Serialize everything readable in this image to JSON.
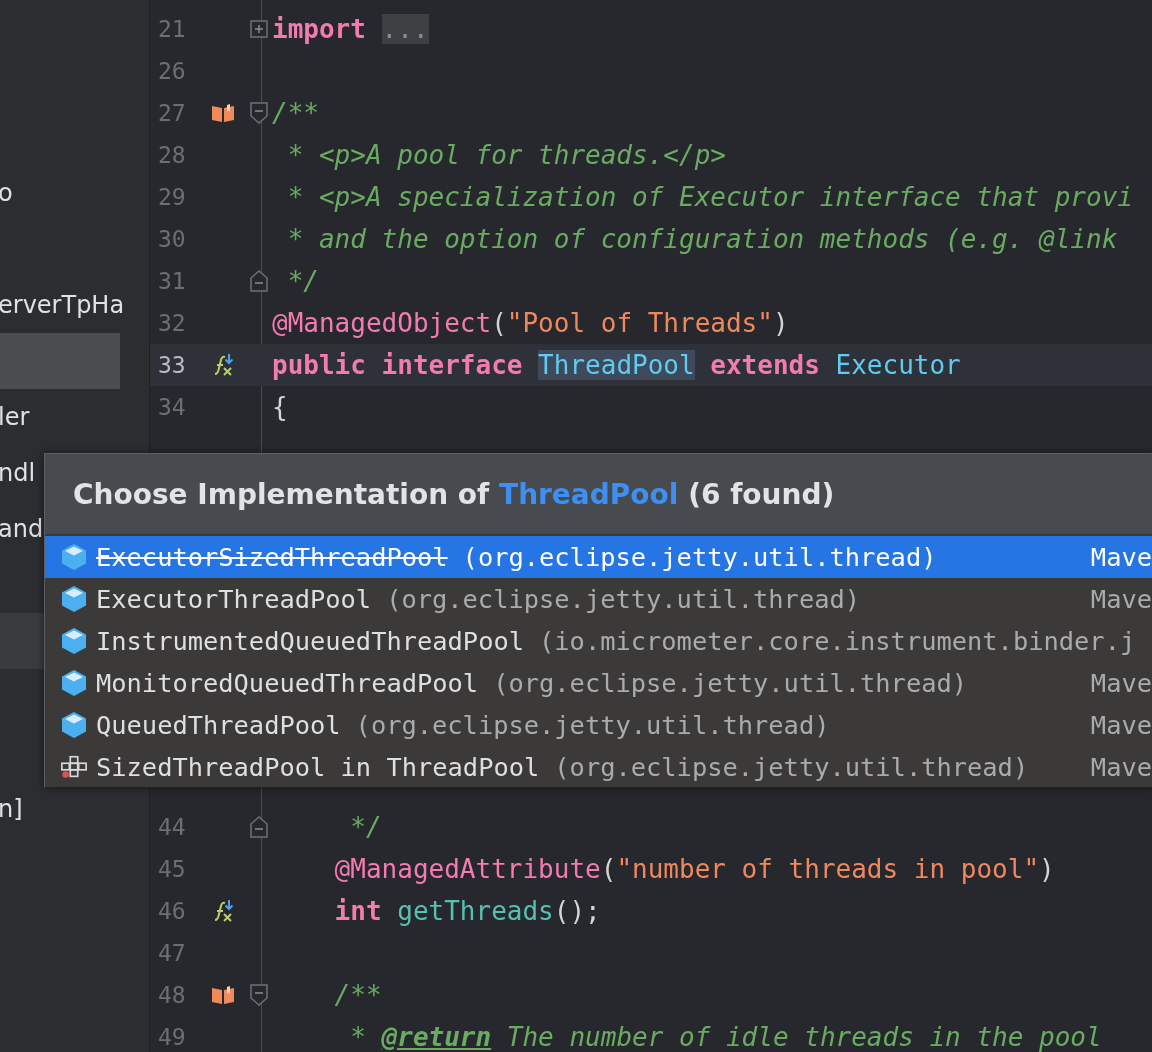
{
  "sidebar": {
    "items": [
      {
        "label": "o",
        "selected": false,
        "hovered": false
      },
      {
        "label": "erverTpHa",
        "selected": false,
        "hovered": false
      },
      {
        "selected": true,
        "hovered": false
      },
      {
        "label": "ler",
        "selected": false,
        "hovered": false
      },
      {
        "label": "ndl",
        "selected": false,
        "hovered": false
      },
      {
        "label": "and",
        "selected": false,
        "hovered": false
      },
      {
        "selected": false,
        "hovered": true
      },
      {
        "label": "n]",
        "selected": false,
        "hovered": false
      }
    ]
  },
  "editor": {
    "lines_above": [
      {
        "number": "21",
        "kind": "import",
        "current": false,
        "tokens": [
          {
            "text": "import ",
            "kind": "keyword"
          },
          {
            "text": "...",
            "kind": "folded"
          }
        ]
      },
      {
        "number": "26",
        "kind": "plain",
        "current": false
      },
      {
        "number": "27",
        "kind": "javadoc",
        "current": false,
        "tokens": [
          {
            "text": "/**",
            "kind": "comment"
          }
        ]
      },
      {
        "number": "28",
        "kind": "plain",
        "current": false,
        "tokens": [
          {
            "text": " * <p>A pool for threads.</p>",
            "kind": "comment"
          }
        ]
      },
      {
        "number": "29",
        "kind": "plain",
        "current": false,
        "tokens": [
          {
            "text": " * <p>A specialization of Executor interface that provi",
            "kind": "comment"
          }
        ]
      },
      {
        "number": "30",
        "kind": "plain",
        "current": false,
        "tokens": [
          {
            "text": " * and the option of configuration methods (e.g. @link",
            "kind": "comment"
          }
        ]
      },
      {
        "number": "31",
        "kind": "closer",
        "current": false,
        "tokens": [
          {
            "text": " */",
            "kind": "comment"
          }
        ]
      },
      {
        "number": "32",
        "kind": "plain",
        "current": false,
        "tokens": [
          {
            "text": "@ManagedObject",
            "kind": "annotation"
          },
          {
            "text": "(",
            "kind": "plain"
          },
          {
            "text": "\"Pool of Threads\"",
            "kind": "string"
          },
          {
            "text": ")",
            "kind": "plain"
          }
        ]
      },
      {
        "number": "33",
        "kind": "implemented",
        "current": true,
        "tokens": [
          {
            "text": "public interface ",
            "kind": "keyword"
          },
          {
            "text": "ThreadPool",
            "kind": "type-highlighted"
          },
          {
            "text": " extends ",
            "kind": "keyword"
          },
          {
            "text": "Executor",
            "kind": "type"
          }
        ]
      },
      {
        "number": "34",
        "kind": "plain",
        "current": false,
        "tokens": [
          {
            "text": "{",
            "kind": "plain"
          }
        ]
      }
    ],
    "lines_below": [
      {
        "number": "44",
        "kind": "closer",
        "current": false,
        "tokens": [
          {
            "text": "     */",
            "kind": "comment"
          }
        ]
      },
      {
        "number": "45",
        "kind": "plain",
        "current": false,
        "tokens": [
          {
            "text": "    @ManagedAttribute",
            "kind": "annotation"
          },
          {
            "text": "(",
            "kind": "plain"
          },
          {
            "text": "\"number of threads in pool\"",
            "kind": "string"
          },
          {
            "text": ")",
            "kind": "plain"
          }
        ]
      },
      {
        "number": "46",
        "kind": "implemented",
        "current": false,
        "tokens": [
          {
            "text": "    int ",
            "kind": "keyword"
          },
          {
            "text": "getThreads",
            "kind": "method"
          },
          {
            "text": "();",
            "kind": "plain"
          }
        ]
      },
      {
        "number": "47",
        "kind": "plain",
        "current": false
      },
      {
        "number": "48",
        "kind": "javadoc",
        "current": false,
        "tokens": [
          {
            "text": "    /**",
            "kind": "comment"
          }
        ]
      },
      {
        "number": "49",
        "kind": "plain",
        "current": false,
        "tokens": [
          {
            "text": "     * ",
            "kind": "comment"
          },
          {
            "text": "@return",
            "kind": "doc-tag"
          },
          {
            "text": " The number of idle threads in the pool",
            "kind": "comment"
          }
        ]
      }
    ]
  },
  "popup": {
    "title_start": "Choose Implementation of ",
    "title_target": "ThreadPool",
    "title_end": " (6 found)",
    "items": [
      {
        "name": "ExecutorSizedThreadPool",
        "package": "(org.eclipse.jetty.util.thread)",
        "location": "Mave",
        "kind": "class",
        "deprecated": true,
        "selected": true
      },
      {
        "name": "ExecutorThreadPool",
        "package": "(org.eclipse.jetty.util.thread)",
        "location": "Mave",
        "kind": "class",
        "deprecated": false,
        "selected": false
      },
      {
        "name": "InstrumentedQueuedThreadPool",
        "package": "(io.micrometer.core.instrument.binder.j",
        "kind": "class",
        "deprecated": false,
        "selected": false
      },
      {
        "name": "MonitoredQueuedThreadPool",
        "package": "(org.eclipse.jetty.util.thread)",
        "location": "Mave",
        "kind": "class",
        "deprecated": false,
        "selected": false
      },
      {
        "name": "QueuedThreadPool",
        "package": "(org.eclipse.jetty.util.thread)",
        "location": "Mave",
        "kind": "class",
        "deprecated": false,
        "selected": false
      },
      {
        "name": "SizedThreadPool in ThreadPool",
        "package": "(org.eclipse.jetty.util.thread)",
        "location": "Mave",
        "kind": "inner",
        "deprecated": false,
        "selected": false
      }
    ]
  }
}
